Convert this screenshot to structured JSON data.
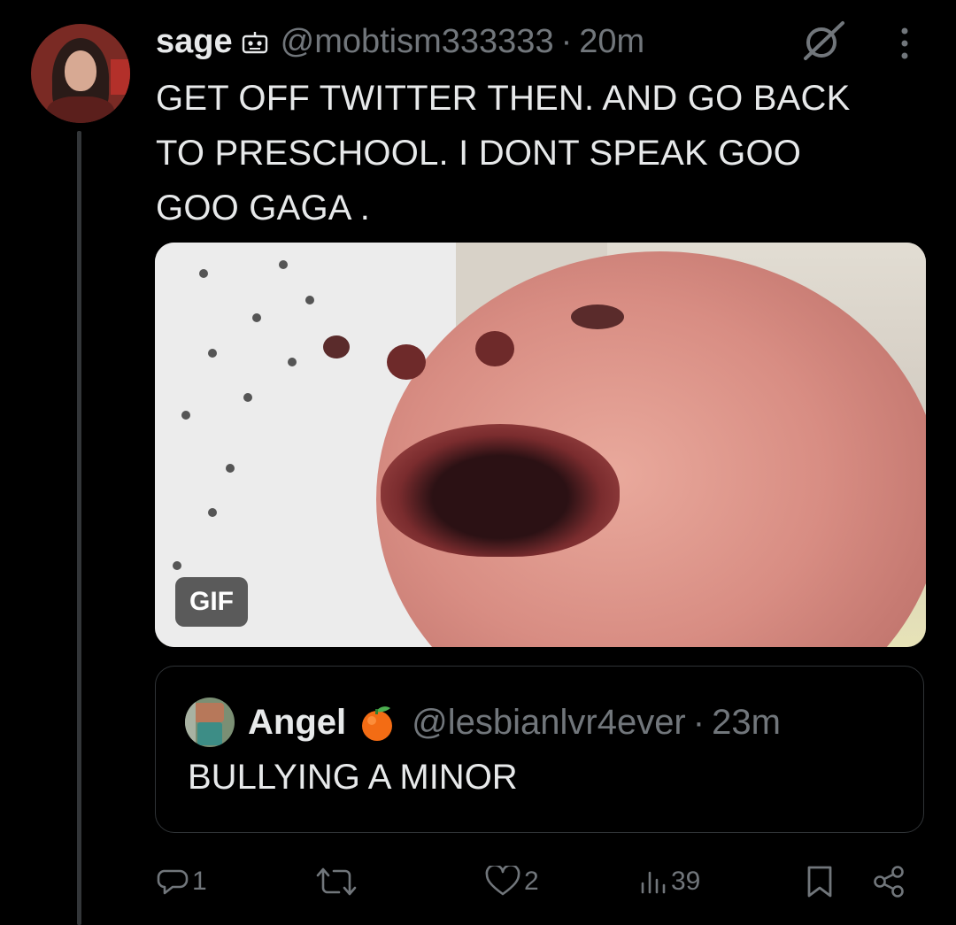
{
  "tweet": {
    "author_name": "sage",
    "author_handle": "@mobtism333333",
    "separator": "·",
    "time": "20m",
    "text": "GET OFF TWITTER THEN. AND GO BACK\nTO PRESCHOOL. I DONT SPEAK GOO\nGOO GAGA .",
    "media_badge": "GIF"
  },
  "quote": {
    "author_name": "Angel",
    "author_handle": "@lesbianlvr4ever",
    "separator": "·",
    "time": "23m",
    "text": "BULLYING A MINOR"
  },
  "actions": {
    "replies": "1",
    "reposts": "",
    "likes": "2",
    "views": "39"
  },
  "icons": {
    "author_badge": "robot-face-icon",
    "grok": "grok-icon",
    "more": "more-vertical-icon",
    "quote_badge": "tangerine-emoji-icon",
    "reply": "reply-icon",
    "repost": "repost-icon",
    "like": "heart-icon",
    "views": "views-icon",
    "bookmark": "bookmark-icon",
    "share": "share-icon"
  },
  "colors": {
    "background": "#000000",
    "text_primary": "#e7e9ea",
    "text_secondary": "#71767b",
    "border": "#2f3336"
  }
}
